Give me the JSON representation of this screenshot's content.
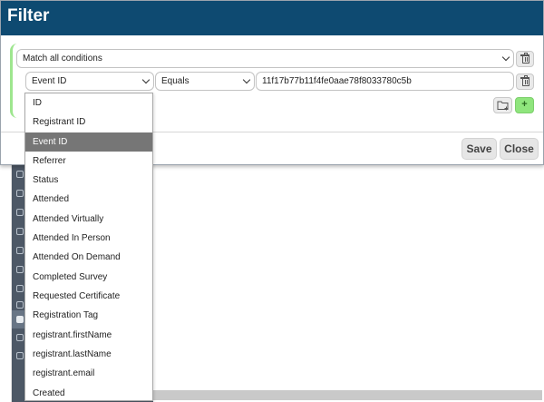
{
  "modal": {
    "title": "Filter",
    "match_select": {
      "value": "Match all conditions"
    },
    "condition": {
      "field": {
        "value": "Event ID"
      },
      "operator": {
        "value": "Equals"
      },
      "value": "11f17b77b11f4fe0aae78f8033780c5b"
    },
    "add_label": "+",
    "buttons": {
      "save": "Save",
      "close": "Close"
    }
  },
  "dropdown": {
    "selected": "Event ID",
    "options": [
      "ID",
      "Registrant ID",
      "Event ID",
      "Referrer",
      "Status",
      "Attended",
      "Attended Virtually",
      "Attended In Person",
      "Attended On Demand",
      "Completed Survey",
      "Requested Certificate",
      "Registration Tag",
      "registrant.firstName",
      "registrant.lastName",
      "registrant.email",
      "Created"
    ]
  },
  "icons": {
    "delete_group": "trash-icon",
    "delete_condition": "trash-icon",
    "add_group": "folder-plus-icon",
    "add_condition": "plus-icon",
    "dropdown": "chevron-down-icon"
  },
  "colors": {
    "header": "#0e4a71",
    "group_border": "#9ee68f",
    "add_button": "#8fe57d",
    "selected_option": "#767676",
    "sidebar": "#4d5866"
  }
}
